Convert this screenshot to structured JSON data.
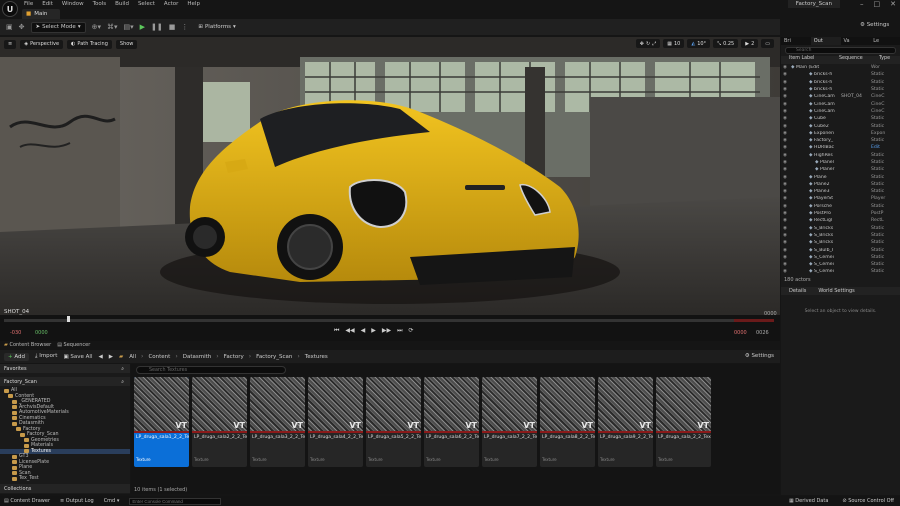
{
  "menubar": {
    "logo": "U",
    "items": [
      "File",
      "Edit",
      "Window",
      "Tools",
      "Build",
      "Select",
      "Actor",
      "Help"
    ],
    "project": "Factory_Scan"
  },
  "main_tab": "Main",
  "toolbar": {
    "select_mode": "Select Mode",
    "platforms": "Platforms",
    "settings": "Settings"
  },
  "viewport_bar": {
    "perspective": "Perspective",
    "path_tracing": "Path Tracing",
    "show": "Show",
    "grid": "10",
    "angle": "10°",
    "scale": "0.25",
    "cam": "2"
  },
  "sequencer": {
    "shot": "SHOT_04",
    "start_red": "-030",
    "start_green": "0000",
    "end_top": "0000",
    "end_red": "0000",
    "end_right": "0026"
  },
  "panel_tabs": [
    "Content Browser",
    "Sequencer"
  ],
  "cb_toolbar": {
    "add": "Add",
    "import": "Import",
    "save_all": "Save All",
    "breadcrumb": [
      "All",
      "Content",
      "Datasmith",
      "Factory",
      "Factory_Scan",
      "Textures"
    ],
    "settings": "Settings"
  },
  "left_panel": {
    "favorites": "Favorites",
    "root": "Factory_Scan",
    "tree": [
      {
        "label": "All",
        "indent": 0
      },
      {
        "label": "Content",
        "indent": 1
      },
      {
        "label": "_GENERATED",
        "indent": 2
      },
      {
        "label": "ArchvisDefault",
        "indent": 2
      },
      {
        "label": "AutomotiveMaterials",
        "indent": 2
      },
      {
        "label": "Cinematics",
        "indent": 2
      },
      {
        "label": "Datasmith",
        "indent": 2
      },
      {
        "label": "Factory",
        "indent": 3
      },
      {
        "label": "Factory_Scan",
        "indent": 4
      },
      {
        "label": "Geometries",
        "indent": 5
      },
      {
        "label": "Materials",
        "indent": 5
      },
      {
        "label": "Textures",
        "indent": 5,
        "selected": true
      },
      {
        "label": "GT3",
        "indent": 2
      },
      {
        "label": "LicensePlate",
        "indent": 2
      },
      {
        "label": "Plane",
        "indent": 2
      },
      {
        "label": "Scan",
        "indent": 2
      },
      {
        "label": "Tex_Test",
        "indent": 2
      }
    ],
    "collections": "Collections"
  },
  "search_placeholder": "Search Textures",
  "assets": [
    {
      "name": "LP_druga_sala1_2_2_Tex",
      "type": "Texture",
      "selected": true
    },
    {
      "name": "LP_druga_sala2_2_2_Tex",
      "type": "Texture"
    },
    {
      "name": "LP_druga_sala3_2_2_Tex",
      "type": "Texture"
    },
    {
      "name": "LP_druga_sala4_2_2_Tex",
      "type": "Texture"
    },
    {
      "name": "LP_druga_sala5_2_2_Tex",
      "type": "Texture"
    },
    {
      "name": "LP_druga_sala6_2_2_Tex",
      "type": "Texture"
    },
    {
      "name": "LP_druga_sala7_2_2_Tex",
      "type": "Texture"
    },
    {
      "name": "LP_druga_sala8_2_2_Tex",
      "type": "Texture"
    },
    {
      "name": "LP_druga_sala9_2_2_Tex",
      "type": "Texture"
    },
    {
      "name": "LP_druga_sala_2_2_Tex",
      "type": "Texture"
    }
  ],
  "vt_badge": "VT",
  "item_count": "10 items (1 selected)",
  "statusbar": {
    "content_drawer": "Content Drawer",
    "output_log": "Output Log",
    "cmd": "Cmd",
    "cmd_placeholder": "Enter Console Command",
    "derived": "Derived Data",
    "source": "Source Control Off"
  },
  "outliner": {
    "tabs": [
      "Bri",
      "Out",
      "Va",
      "Le"
    ],
    "search_placeholder": "Search",
    "col_label": "Item Label",
    "col_sequence": "Sequence",
    "col_type": "Type",
    "rows": [
      {
        "name": "Main (Edit",
        "type": "Wor"
      },
      {
        "name": "bricks-h",
        "type": "Static"
      },
      {
        "name": "bricks-h",
        "type": "Static"
      },
      {
        "name": "bricks-h",
        "type": "Static"
      },
      {
        "name": "CineCam",
        "seq": "SHOT_04",
        "type": "CineC"
      },
      {
        "name": "CineCam",
        "type": "CineC"
      },
      {
        "name": "CineCam",
        "type": "CineC"
      },
      {
        "name": "Cube",
        "type": "Static"
      },
      {
        "name": "Cube2",
        "type": "Static"
      },
      {
        "name": "Exponen",
        "type": "Expon"
      },
      {
        "name": "Factory_",
        "type": "Static"
      },
      {
        "name": "HDRIBac",
        "type": "Edit",
        "edit": true
      },
      {
        "name": "HighRes",
        "type": "Static"
      },
      {
        "name": "Planel",
        "type": "Static"
      },
      {
        "name": "Planer",
        "type": "Static"
      },
      {
        "name": "Plane",
        "type": "Static"
      },
      {
        "name": "Plane2",
        "type": "Static"
      },
      {
        "name": "Plane3",
        "type": "Static"
      },
      {
        "name": "PlayerSt",
        "type": "Player"
      },
      {
        "name": "Porsche",
        "type": "Static"
      },
      {
        "name": "PostPro",
        "type": "PostP"
      },
      {
        "name": "RectLigl",
        "type": "RectL"
      },
      {
        "name": "S_Bricks",
        "type": "Static"
      },
      {
        "name": "S_Bricks",
        "type": "Static"
      },
      {
        "name": "S_Bricks",
        "type": "Static"
      },
      {
        "name": "S_Bulb_I",
        "type": "Static"
      },
      {
        "name": "S_Cemei",
        "type": "Static"
      },
      {
        "name": "S_Cemei",
        "type": "Static"
      },
      {
        "name": "S_Cemei",
        "type": "Static"
      }
    ],
    "actor_count": "180 actors"
  },
  "details": {
    "tab": "Details",
    "tab2": "World Settings",
    "message": "Select an object to view details."
  },
  "colors": {
    "accent": "#0b6fd8",
    "car": "#e6b817",
    "folder": "#c79a4a"
  }
}
